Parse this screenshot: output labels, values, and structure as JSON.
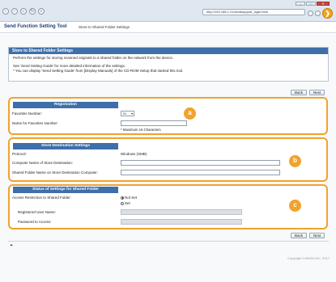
{
  "browser": {
    "address": "http://192.168.1.21/sendsupport_login.html",
    "address_host": "192.168.1.21",
    "window_buttons": [
      "–",
      "□",
      "✕"
    ],
    "go_glyph": "❯"
  },
  "app": {
    "title": "Send Function Setting Tool",
    "page": "Store to Shared Folder Settings"
  },
  "info": {
    "title": "Store to Shared Folder Settings",
    "line1": "Perform the settings for storing scanned originals to a shared folder on the network from the device.",
    "line2": "See 'Send Setting Guide' for more detailed information of the settings.",
    "line3": "* You can display 'Send Setting Guide' from [Display Manuals] of the CD-ROM Setup that started this tool."
  },
  "buttons": {
    "back": "Back",
    "next": "Next"
  },
  "registration": {
    "header": "Registration",
    "favorites_label": "Favorites Number:",
    "favorites_value": "01",
    "name_label": "Name for Favorites Number:",
    "name_value": "",
    "max_note": "* Maximum 16 Characters",
    "badge": "a"
  },
  "destination": {
    "header": "Store Destination Settings",
    "protocol_label": "Protocol:",
    "protocol_value": "Windows (SMB)",
    "computer_label": "Computer Name of Store Destination:",
    "computer_value": "",
    "folder_label": "Shared Folder Name on Store Destination Computer:",
    "folder_value": "",
    "badge": "b"
  },
  "status": {
    "header": "Status of Settings for Shared Folder",
    "access_label": "Access Restriction to Shared Folder:",
    "opt_notset": "Not Set",
    "opt_set": "Set",
    "user_label": "Registered User Name:",
    "pass_label": "Password to Access:",
    "badge": "c"
  },
  "footer": {
    "copyright": "Copyright CANON INC. 2017",
    "up_glyph": "⏶"
  }
}
